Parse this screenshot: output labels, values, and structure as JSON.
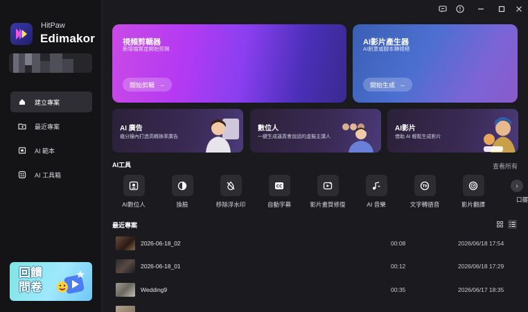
{
  "brand": {
    "top": "HitPaw",
    "main": "Edimakor"
  },
  "sidebar": {
    "items": [
      {
        "label": "建立專案",
        "icon": "home-icon"
      },
      {
        "label": "最近專案",
        "icon": "folder-icon"
      },
      {
        "label": "AI 範本",
        "icon": "template-icon"
      },
      {
        "label": "AI 工具箱",
        "icon": "toolbox-icon"
      }
    ],
    "banner_text": "回饋問卷"
  },
  "hero": [
    {
      "title": "視頻剪輯器",
      "subtitle": "新增檔案並開始剪輯",
      "button": "開始剪輯",
      "arrow": "→"
    },
    {
      "title": "AI影片產生器",
      "subtitle": "AI創意或腳本轉視頻",
      "button": "開始生成",
      "arrow": "→"
    }
  ],
  "cards": [
    {
      "title": "AI 廣告",
      "subtitle": "幾分鐘內打造高轉換率廣告"
    },
    {
      "title": "數位人",
      "subtitle": "一鍵生成逼真會說話的虛擬主講人"
    },
    {
      "title": "AI影片",
      "subtitle": "借助 AI 輕鬆生成影片"
    }
  ],
  "ai_tools": {
    "section_title": "AI工具",
    "see_all": "查看所有",
    "items": [
      {
        "label": "AI數位人",
        "icon": "avatar-icon"
      },
      {
        "label": "換臉",
        "icon": "face-swap-icon"
      },
      {
        "label": "移除浮水印",
        "icon": "watermark-remove-icon"
      },
      {
        "label": "自動字幕",
        "icon": "cc-icon"
      },
      {
        "label": "影片畫質修復",
        "icon": "video-enhance-icon"
      },
      {
        "label": "AI 音樂",
        "icon": "music-icon"
      },
      {
        "label": "文字轉語音",
        "icon": "tts-icon"
      },
      {
        "label": "影片翻譯",
        "icon": "translate-icon"
      },
      {
        "label": "口擺",
        "icon": "next-icon"
      }
    ],
    "next": "›"
  },
  "recent": {
    "section_title": "最近專案",
    "rows": [
      {
        "name": "2026-06-18_02",
        "duration": "00:08",
        "date": "2026/06/18 17:54",
        "thumb_color": "#6a4a3a"
      },
      {
        "name": "2026-06-18_01",
        "duration": "00:12",
        "date": "2026/06/18 17:29",
        "thumb_color": "#3a3a44"
      },
      {
        "name": "Wedding9",
        "duration": "00:35",
        "date": "2026/06/17 18:35",
        "thumb_color": "#8b8a80"
      },
      {
        "name": "",
        "duration": "",
        "date": "",
        "thumb_color": "#9a8a78"
      }
    ]
  },
  "colors": {
    "bg": "#1b1b1f",
    "sidebar": "#141417",
    "accent_purple": "#b53af2",
    "accent_blue": "#4a6fd0"
  }
}
